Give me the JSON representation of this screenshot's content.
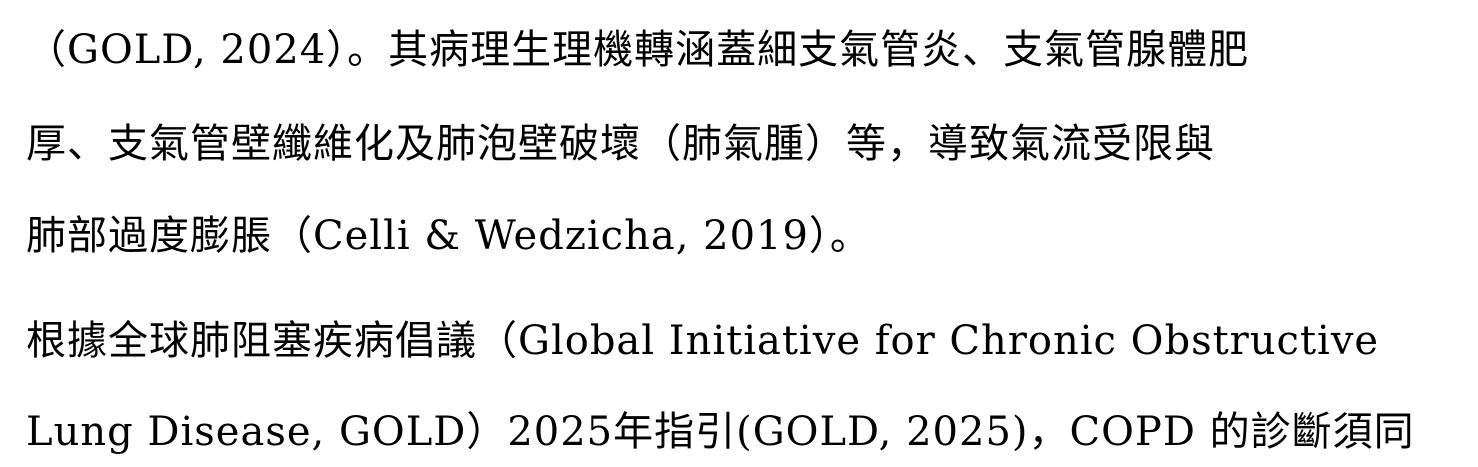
{
  "document": {
    "paragraph_1": {
      "lines": [
        "（GOLD, 2024）。其病理生理機轉涵蓋細支氣管炎、支氣管腺體肥",
        "厚、支氣管壁纖維化及肺泡壁破壞（肺氣腫）等，導致氣流受限與",
        "肺部過度膨脹（Celli & Wedzicha, 2019）。"
      ]
    },
    "paragraph_2": {
      "lines": [
        "根據全球肺阻塞疾病倡議（Global Initiative for Chronic Obstructive",
        "Lung Disease, GOLD）2025年指引(GOLD, 2025)，COPD 的診斷須同"
      ]
    }
  }
}
